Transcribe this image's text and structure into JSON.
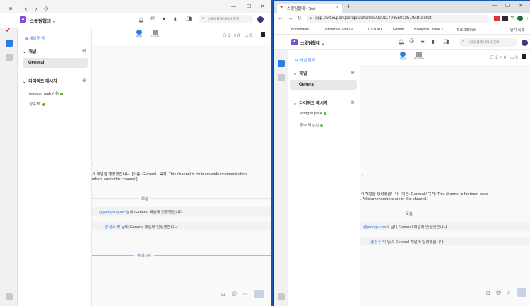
{
  "left_window": {
    "workspace_name": "스윗팀협대",
    "search_placeholder": "스윗팀협대 내에서 검색",
    "min": "—",
    "max": "☐",
    "close": "✕",
    "channel_browse": "채널 탐색",
    "channels_header": "채널",
    "channel_general": "General",
    "dm_header": "다이렉트 메시지",
    "dm_items": [
      "jeongsu park (나)",
      "정수 박"
    ],
    "tab_chat": "채팅",
    "tab_board": "BOARD",
    "members_count": "2",
    "files_count": "0",
    "tasks_count": "0",
    "channel_created_text": "개 채널을 생성했습니다. [이름: General / 목적: This channel is for team-wide communication",
    "channel_created_text2": "mbers are in this channel.]",
    "today_label": "오늘",
    "join1_mention": "@jeongsu park",
    "join1_rest": "님이 General 채널에 입장했습니다.",
    "join2_mention": "@정수 박",
    "join2_rest": "님이 General 채널에 입장했습니다.",
    "new_message_label": "새 메시지",
    "back_arrow": "‹"
  },
  "right_window": {
    "tab_title": "스윗팀협대 - Swit",
    "url": "app.swit.io/parkjeongsu/channel/220117045501357/MBU/chat",
    "bookmarks": [
      "Bookmarks",
      "Universal JVM GC...",
      "TISTORY",
      "GitHub",
      "Baekjoon Online J...",
      "프로그래머스",
      "읽기 목록"
    ],
    "workspace_name": "스윗팀협대",
    "search_placeholder": "스윗팀협대 내에서 검색",
    "channel_browse": "채널 탐색",
    "channels_header": "채널",
    "channel_general": "General",
    "dm_header": "다이렉트 메시지",
    "dm_items": [
      "jeongsu park",
      "정수 박 (나)"
    ],
    "tab_chat": "채팅",
    "tab_board": "BOARD",
    "members_count": "2",
    "files_count": "0",
    "tasks_count": "0",
    "channel_created_text": "개 채널을 생성했습니다. [이름: General / 목적: This channel is for team-wide",
    "channel_created_text2": ". All team members are in this channel.]",
    "today_label": "오늘",
    "join1_mention": "@jeongsu park",
    "join1_rest": "님이 General 채널에 입장했습니다.",
    "join2_mention": "@정수 박",
    "join2_rest": "님이 General 채널에 입장했습니다.",
    "back_arrow": "‹"
  },
  "colors": {
    "accent": "#2a7de1",
    "online": "#5cbb2a",
    "workspace_badge": "#7b4fd6",
    "desktop": "#1a56b8"
  }
}
